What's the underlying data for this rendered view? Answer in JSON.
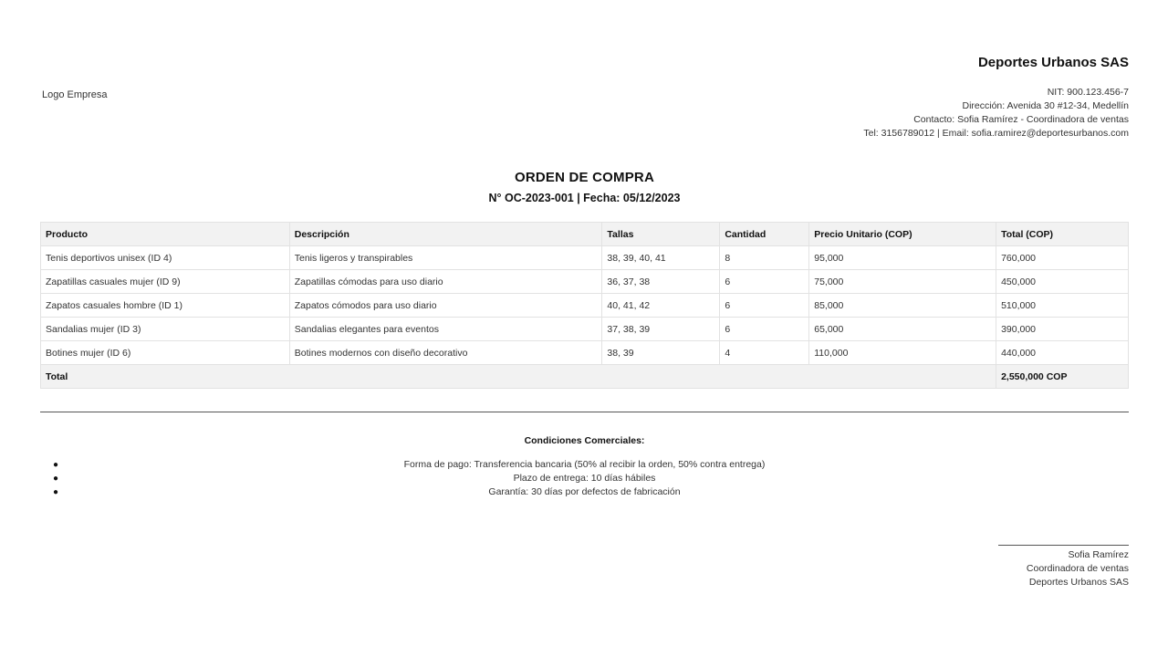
{
  "logo": {
    "alt_text": "Logo Empresa"
  },
  "company": {
    "name": "Deportes Urbanos SAS",
    "nit": "NIT: 900.123.456-7",
    "address": "Dirección: Avenida 30 #12-34, Medellín",
    "contact": "Contacto: Sofia Ramírez - Coordinadora de ventas",
    "phone_email": "Tel: 3156789012 | Email: sofia.ramirez@deportesurbanos.com"
  },
  "document": {
    "title": "ORDEN DE COMPRA",
    "subtitle": "N° OC-2023-001 | Fecha: 05/12/2023"
  },
  "table": {
    "headers": [
      "Producto",
      "Descripción",
      "Tallas",
      "Cantidad",
      "Precio Unitario (COP)",
      "Total (COP)"
    ],
    "rows": [
      [
        "Tenis deportivos unisex (ID 4)",
        "Tenis ligeros y transpirables",
        "38, 39, 40, 41",
        "8",
        "95,000",
        "760,000"
      ],
      [
        "Zapatillas casuales mujer (ID 9)",
        "Zapatillas cómodas para uso diario",
        "36, 37, 38",
        "6",
        "75,000",
        "450,000"
      ],
      [
        "Zapatos casuales hombre (ID 1)",
        "Zapatos cómodos para uso diario",
        "40, 41, 42",
        "6",
        "85,000",
        "510,000"
      ],
      [
        "Sandalias mujer (ID 3)",
        "Sandalias elegantes para eventos",
        "37, 38, 39",
        "6",
        "65,000",
        "390,000"
      ],
      [
        "Botines mujer (ID 6)",
        "Botines modernos con diseño decorativo",
        "38, 39",
        "4",
        "110,000",
        "440,000"
      ]
    ],
    "total_label": "Total",
    "total_value": "2,550,000 COP"
  },
  "conditions": {
    "title": "Condiciones Comerciales:",
    "items": [
      "Forma de pago: Transferencia bancaria (50% al recibir la orden, 50% contra entrega)",
      "Plazo de entrega: 10 días hábiles",
      "Garantía: 30 días por defectos de fabricación"
    ]
  },
  "signature": {
    "name": "Sofia Ramírez",
    "role": "Coordinadora de ventas",
    "company": "Deportes Urbanos SAS"
  },
  "colors": {
    "header_bg": "#f2f2f2",
    "border": "#e2e2e2",
    "text": "#333333"
  }
}
